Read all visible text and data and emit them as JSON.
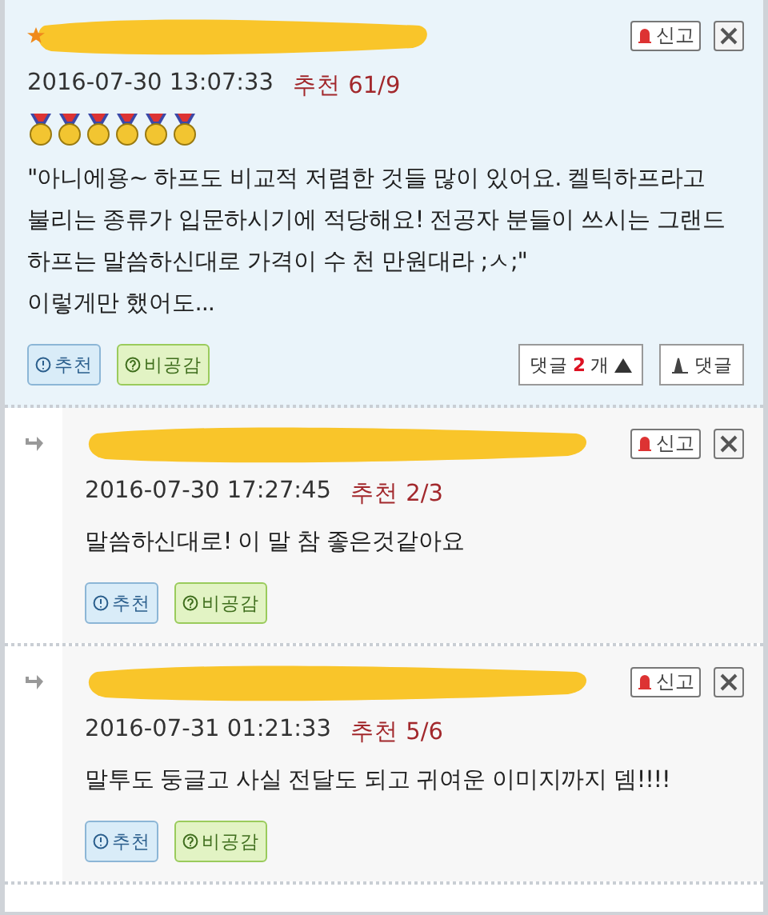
{
  "comments": [
    {
      "kind": "main",
      "starred": true,
      "report": "신고",
      "date": "2016-07-30 13:07:33",
      "votes_label": "추천",
      "votes": "61/9",
      "badges": [
        {
          "kind": "medal"
        },
        {
          "kind": "medal"
        },
        {
          "kind": "medal"
        },
        {
          "kind": "medal"
        },
        {
          "kind": "medal"
        },
        {
          "kind": "medal"
        }
      ],
      "text": "\"아니에용~ 하프도 비교적 저렴한 것들 많이 있어요. 켈틱하프라고 불리는 종류가 입문하시기에 적당해요! 전공자 분들이 쓰시는 그랜드 하프는 말씀하신대로 가격이 수 천 만원대라 ;ㅅ;\"\n이렇게만 했어도...",
      "recommend": "추천",
      "disagree": "비공감",
      "replies_toggle": {
        "prefix": "댓글",
        "count": "2",
        "suffix": "개",
        "expanded": true
      },
      "reply_button": "댓글"
    },
    {
      "kind": "reply",
      "starred": false,
      "report": "신고",
      "date": "2016-07-30 17:27:45",
      "votes_label": "추천",
      "votes": "2/3",
      "text": "말씀하신대로! 이 말 참 좋은것같아요",
      "recommend": "추천",
      "disagree": "비공감"
    },
    {
      "kind": "reply",
      "starred": false,
      "report": "신고",
      "date": "2016-07-31 01:21:33",
      "votes_label": "추천",
      "votes": "5/6",
      "text": "말투도 둥글고 사실 전달도 되고 귀여운 이미지까지 뎀!!!!",
      "recommend": "추천",
      "disagree": "비공감"
    }
  ]
}
